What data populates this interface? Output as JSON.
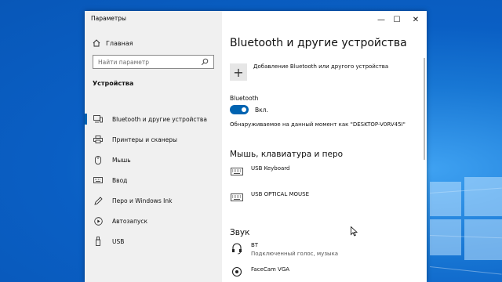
{
  "window": {
    "title": "Параметры",
    "controls": {
      "minimize": "—",
      "maximize": "☐",
      "close": "✕"
    }
  },
  "sidebar": {
    "home_label": "Главная",
    "search_placeholder": "Найти параметр",
    "section_title": "Устройства",
    "items": [
      {
        "label": "Bluetooth и другие устройства",
        "icon": "bluetooth-devices-icon",
        "active": true
      },
      {
        "label": "Принтеры и сканеры",
        "icon": "printer-icon"
      },
      {
        "label": "Мышь",
        "icon": "mouse-icon"
      },
      {
        "label": "Ввод",
        "icon": "keyboard-icon"
      },
      {
        "label": "Перо и Windows Ink",
        "icon": "pen-icon"
      },
      {
        "label": "Автозапуск",
        "icon": "autoplay-icon"
      },
      {
        "label": "USB",
        "icon": "usb-icon"
      }
    ]
  },
  "main": {
    "title": "Bluetooth и другие устройства",
    "add_device_label": "Добавление Bluetooth или другого устройства",
    "bluetooth_label": "Bluetooth",
    "bluetooth_state": "Вкл.",
    "discoverable_text": "Обнаруживаемое на данный момент как \"DESKTOP-V0RV45I\"",
    "section_input": "Мышь, клавиатура и перо",
    "input_devices": [
      {
        "name": "USB Keyboard",
        "icon": "keyboard-icon"
      },
      {
        "name": "USB OPTICAL MOUSE",
        "icon": "keyboard-icon"
      }
    ],
    "section_audio": "Звук",
    "audio_devices": [
      {
        "name": "BT",
        "status": "Подключенный голос, музыка",
        "icon": "headset-icon"
      },
      {
        "name": "FaceCam VGA",
        "status": "",
        "icon": "webcam-icon"
      }
    ]
  },
  "colors": {
    "accent": "#0063b1",
    "desktop": "#0a5fc4",
    "sidebar": "#f0f0f0"
  }
}
